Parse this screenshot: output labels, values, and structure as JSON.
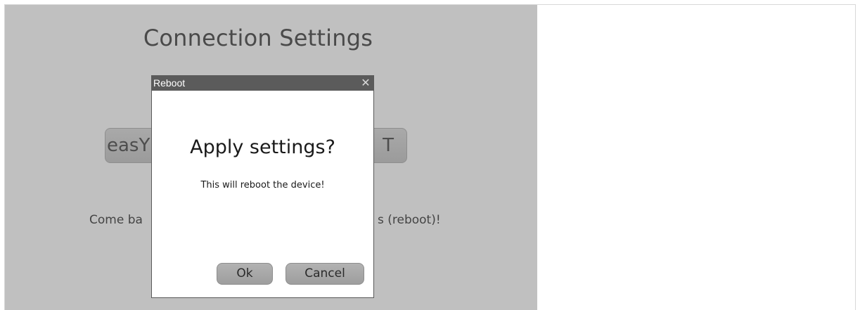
{
  "page": {
    "title": "Connection Settings",
    "wifi_button_left": "easY",
    "wifi_button_right": "T",
    "comeback_left": "Come ba",
    "comeback_right": "s (reboot)!"
  },
  "dialog": {
    "title": "Reboot",
    "close_symbol": "✕",
    "heading": "Apply settings?",
    "message": "This will reboot the device!",
    "ok_label": "Ok",
    "cancel_label": "Cancel"
  },
  "colors": {
    "overlay_background": "#c0c0c0",
    "titlebar": "#5b5b5b",
    "button": "#a9a9a9"
  }
}
